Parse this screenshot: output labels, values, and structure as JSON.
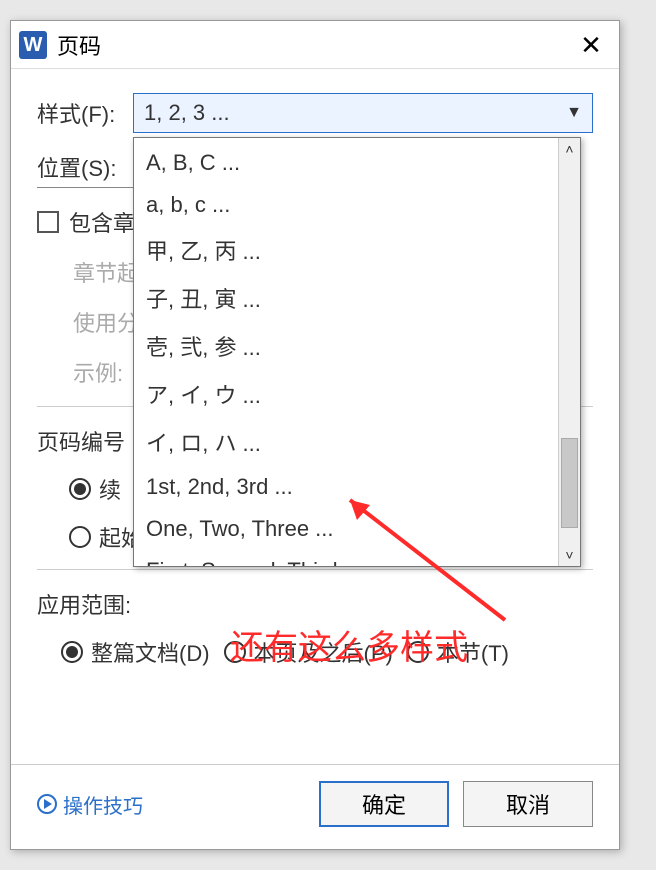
{
  "dialog": {
    "title": "页码",
    "app_icon_letter": "W"
  },
  "style": {
    "label": "样式(F):",
    "selected": "1, 2, 3 ...",
    "options": [
      "A, B, C ...",
      "a, b, c ...",
      "甲, 乙, 丙 ...",
      "子, 丑, 寅 ...",
      "壱, 弐, 参 ...",
      "ア, イ, ウ ...",
      "イ, ロ, ハ ...",
      "1st, 2nd, 3rd ...",
      "One, Two, Three ...",
      "First, Second, Third ..."
    ]
  },
  "position": {
    "label": "位置(S):"
  },
  "include_chapter": {
    "label": "包含章",
    "chapter_start_label": "章节起",
    "separator_label": "使用分",
    "example_label": "示例:"
  },
  "numbering": {
    "section_label": "页码编号",
    "continue_label": "续",
    "start_at_label": "起始页码(A):",
    "start_value": ""
  },
  "apply_to": {
    "section_label": "应用范围:",
    "whole_doc": "整篇文档(D)",
    "this_page_after": "本页及之后(P)",
    "this_section": "本节(T)"
  },
  "footer": {
    "tips": "操作技巧",
    "ok": "确定",
    "cancel": "取消"
  },
  "annotation": {
    "text": "还有这么多样式"
  }
}
